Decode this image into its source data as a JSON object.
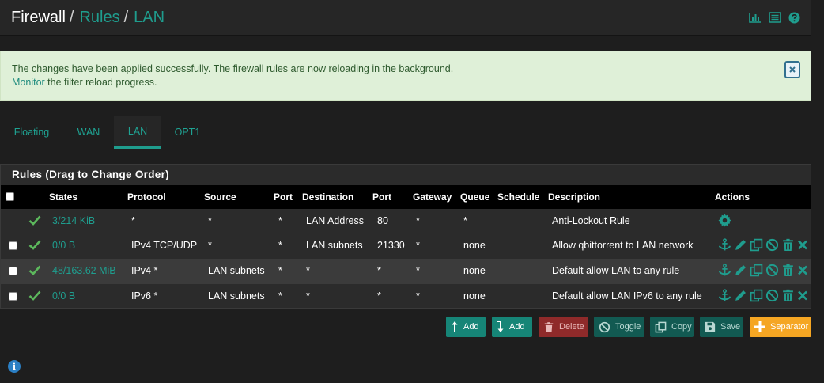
{
  "breadcrumb": {
    "root": "Firewall",
    "rules": "Rules",
    "iface": "LAN",
    "separator": "/"
  },
  "header_icons": [
    "chart-icon",
    "list-icon",
    "help-icon"
  ],
  "alert": {
    "line1": "The changes have been applied successfully. The firewall rules are now reloading in the background.",
    "monitor_link": "Monitor",
    "line2_rest": " the filter reload progress."
  },
  "tabs": [
    {
      "label": "Floating",
      "active": false
    },
    {
      "label": "WAN",
      "active": false
    },
    {
      "label": "LAN",
      "active": true
    },
    {
      "label": "OPT1",
      "active": false
    }
  ],
  "panel": {
    "title": "Rules (Drag to Change Order)"
  },
  "table": {
    "headers": {
      "states": "States",
      "protocol": "Protocol",
      "source": "Source",
      "src_port": "Port",
      "destination": "Destination",
      "dst_port": "Port",
      "gateway": "Gateway",
      "queue": "Queue",
      "schedule": "Schedule",
      "description": "Description",
      "actions": "Actions"
    },
    "rows": [
      {
        "states": "3/214 KiB",
        "protocol": "*",
        "source": "*",
        "src_port": "*",
        "destination": "LAN Address",
        "dst_port": "80",
        "gateway": "*",
        "queue": "*",
        "schedule": "",
        "description": "Anti-Lockout Rule"
      },
      {
        "states": "0/0 B",
        "protocol": "IPv4 TCP/UDP",
        "source": "*",
        "src_port": "*",
        "destination": "LAN subnets",
        "dst_port": "21330",
        "gateway": "*",
        "queue": "none",
        "schedule": "",
        "description": "Allow qbittorrent to LAN network"
      },
      {
        "states": "48/163.62 MiB",
        "protocol": "IPv4 *",
        "source": "LAN subnets",
        "src_port": "*",
        "destination": "*",
        "dst_port": "*",
        "gateway": "*",
        "queue": "none",
        "schedule": "",
        "description": "Default allow LAN to any rule"
      },
      {
        "states": "0/0 B",
        "protocol": "IPv6 *",
        "source": "LAN subnets",
        "src_port": "*",
        "destination": "*",
        "dst_port": "*",
        "gateway": "*",
        "queue": "none",
        "schedule": "",
        "description": "Default allow LAN IPv6 to any rule"
      }
    ]
  },
  "buttons": {
    "add_top": "Add",
    "add_bottom": "Add",
    "delete": "Delete",
    "toggle": "Toggle",
    "copy": "Copy",
    "save": "Save",
    "separator": "Separator"
  },
  "colors": {
    "accent": "#1f9d8e",
    "alert_bg": "#dff0d8",
    "check_green": "#5cb85c",
    "orange": "#f5a623",
    "delete_red": "#8f2a2a"
  }
}
